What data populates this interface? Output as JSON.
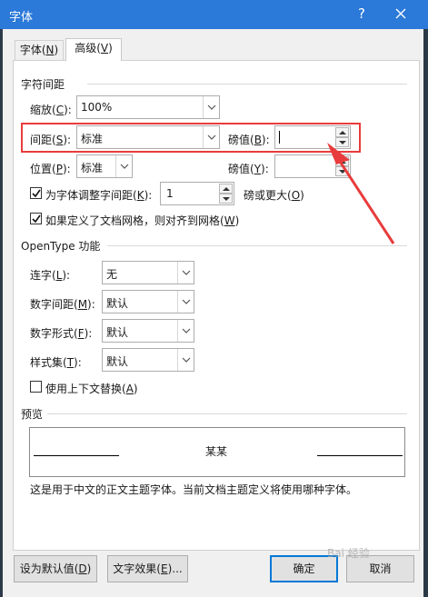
{
  "window": {
    "title": "字体",
    "help_label": "?"
  },
  "tabs": [
    {
      "label_pre": "字体(",
      "key": "N",
      "label_post": ")"
    },
    {
      "label_pre": "高级(",
      "key": "V",
      "label_post": ")"
    }
  ],
  "spacing": {
    "header": "字符间距",
    "scale": {
      "label_pre": "缩放(",
      "key": "C",
      "label_post": "):",
      "value": "100%"
    },
    "spacing": {
      "label_pre": "间距(",
      "key": "S",
      "label_post": "):",
      "value": "标准"
    },
    "spacing_by": {
      "label_pre": "磅值(",
      "key": "B",
      "label_post": "):",
      "value": ""
    },
    "position": {
      "label_pre": "位置(",
      "key": "P",
      "label_post": "):",
      "value": "标准"
    },
    "position_by": {
      "label_pre": "磅值(",
      "key": "Y",
      "label_post": "):",
      "value": ""
    },
    "kerning": {
      "label_pre": "为字体调整字间距(",
      "key": "K",
      "label_post": "):",
      "value": "1",
      "suffix_pre": "磅或更大(",
      "suffix_key": "O",
      "suffix_post": ")",
      "checked": true
    },
    "grid": {
      "label_pre": "如果定义了文档网格，则对齐到网格(",
      "key": "W",
      "label_post": ")",
      "checked": true
    }
  },
  "opentype": {
    "header": "OpenType 功能",
    "ligatures": {
      "label_pre": "连字(",
      "key": "L",
      "label_post": "):",
      "value": "无"
    },
    "number_spacing": {
      "label_pre": "数字间距(",
      "key": "M",
      "label_post": "):",
      "value": "默认"
    },
    "number_forms": {
      "label_pre": "数字形式(",
      "key": "F",
      "label_post": "):",
      "value": "默认"
    },
    "stylistic_sets": {
      "label_pre": "样式集(",
      "key": "T",
      "label_post": "):",
      "value": "默认"
    },
    "contextual": {
      "label_pre": "使用上下文替换(",
      "key": "A",
      "label_post": ")",
      "checked": false
    }
  },
  "preview": {
    "header": "预览",
    "sample": "某某",
    "note": "这是用于中文的正文主题字体。当前文档主题定义将使用哪种字体。"
  },
  "buttons": {
    "default": {
      "label_pre": "设为默认值(",
      "key": "D",
      "label_post": ")"
    },
    "effects": {
      "label_pre": "文字效果(",
      "key": "E",
      "label_post": ")..."
    },
    "ok": "确定",
    "cancel": "取消"
  },
  "colors": {
    "titlebar": "#2b79d8",
    "annotation": "#e83c3c",
    "ok_border": "#0078d7"
  },
  "watermark": "Bai 经验"
}
